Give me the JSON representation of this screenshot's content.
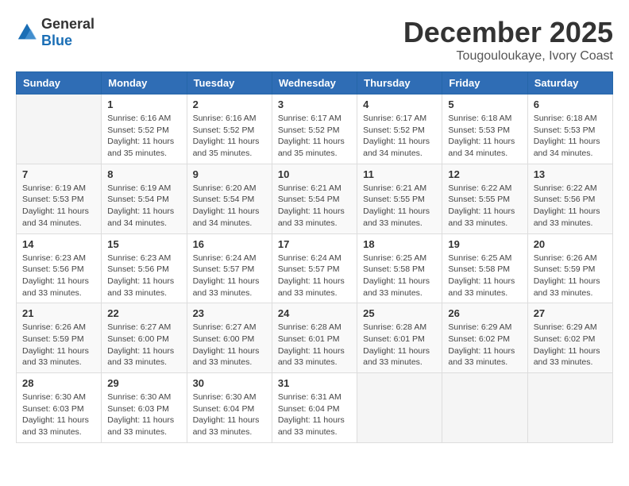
{
  "logo": {
    "text_general": "General",
    "text_blue": "Blue"
  },
  "title": {
    "month": "December 2025",
    "location": "Tougouloukaye, Ivory Coast"
  },
  "headers": [
    "Sunday",
    "Monday",
    "Tuesday",
    "Wednesday",
    "Thursday",
    "Friday",
    "Saturday"
  ],
  "weeks": [
    [
      {
        "day": "",
        "info": ""
      },
      {
        "day": "1",
        "info": "Sunrise: 6:16 AM\nSunset: 5:52 PM\nDaylight: 11 hours and 35 minutes."
      },
      {
        "day": "2",
        "info": "Sunrise: 6:16 AM\nSunset: 5:52 PM\nDaylight: 11 hours and 35 minutes."
      },
      {
        "day": "3",
        "info": "Sunrise: 6:17 AM\nSunset: 5:52 PM\nDaylight: 11 hours and 35 minutes."
      },
      {
        "day": "4",
        "info": "Sunrise: 6:17 AM\nSunset: 5:52 PM\nDaylight: 11 hours and 34 minutes."
      },
      {
        "day": "5",
        "info": "Sunrise: 6:18 AM\nSunset: 5:53 PM\nDaylight: 11 hours and 34 minutes."
      },
      {
        "day": "6",
        "info": "Sunrise: 6:18 AM\nSunset: 5:53 PM\nDaylight: 11 hours and 34 minutes."
      }
    ],
    [
      {
        "day": "7",
        "info": "Sunrise: 6:19 AM\nSunset: 5:53 PM\nDaylight: 11 hours and 34 minutes."
      },
      {
        "day": "8",
        "info": "Sunrise: 6:19 AM\nSunset: 5:54 PM\nDaylight: 11 hours and 34 minutes."
      },
      {
        "day": "9",
        "info": "Sunrise: 6:20 AM\nSunset: 5:54 PM\nDaylight: 11 hours and 34 minutes."
      },
      {
        "day": "10",
        "info": "Sunrise: 6:21 AM\nSunset: 5:54 PM\nDaylight: 11 hours and 33 minutes."
      },
      {
        "day": "11",
        "info": "Sunrise: 6:21 AM\nSunset: 5:55 PM\nDaylight: 11 hours and 33 minutes."
      },
      {
        "day": "12",
        "info": "Sunrise: 6:22 AM\nSunset: 5:55 PM\nDaylight: 11 hours and 33 minutes."
      },
      {
        "day": "13",
        "info": "Sunrise: 6:22 AM\nSunset: 5:56 PM\nDaylight: 11 hours and 33 minutes."
      }
    ],
    [
      {
        "day": "14",
        "info": "Sunrise: 6:23 AM\nSunset: 5:56 PM\nDaylight: 11 hours and 33 minutes."
      },
      {
        "day": "15",
        "info": "Sunrise: 6:23 AM\nSunset: 5:56 PM\nDaylight: 11 hours and 33 minutes."
      },
      {
        "day": "16",
        "info": "Sunrise: 6:24 AM\nSunset: 5:57 PM\nDaylight: 11 hours and 33 minutes."
      },
      {
        "day": "17",
        "info": "Sunrise: 6:24 AM\nSunset: 5:57 PM\nDaylight: 11 hours and 33 minutes."
      },
      {
        "day": "18",
        "info": "Sunrise: 6:25 AM\nSunset: 5:58 PM\nDaylight: 11 hours and 33 minutes."
      },
      {
        "day": "19",
        "info": "Sunrise: 6:25 AM\nSunset: 5:58 PM\nDaylight: 11 hours and 33 minutes."
      },
      {
        "day": "20",
        "info": "Sunrise: 6:26 AM\nSunset: 5:59 PM\nDaylight: 11 hours and 33 minutes."
      }
    ],
    [
      {
        "day": "21",
        "info": "Sunrise: 6:26 AM\nSunset: 5:59 PM\nDaylight: 11 hours and 33 minutes."
      },
      {
        "day": "22",
        "info": "Sunrise: 6:27 AM\nSunset: 6:00 PM\nDaylight: 11 hours and 33 minutes."
      },
      {
        "day": "23",
        "info": "Sunrise: 6:27 AM\nSunset: 6:00 PM\nDaylight: 11 hours and 33 minutes."
      },
      {
        "day": "24",
        "info": "Sunrise: 6:28 AM\nSunset: 6:01 PM\nDaylight: 11 hours and 33 minutes."
      },
      {
        "day": "25",
        "info": "Sunrise: 6:28 AM\nSunset: 6:01 PM\nDaylight: 11 hours and 33 minutes."
      },
      {
        "day": "26",
        "info": "Sunrise: 6:29 AM\nSunset: 6:02 PM\nDaylight: 11 hours and 33 minutes."
      },
      {
        "day": "27",
        "info": "Sunrise: 6:29 AM\nSunset: 6:02 PM\nDaylight: 11 hours and 33 minutes."
      }
    ],
    [
      {
        "day": "28",
        "info": "Sunrise: 6:30 AM\nSunset: 6:03 PM\nDaylight: 11 hours and 33 minutes."
      },
      {
        "day": "29",
        "info": "Sunrise: 6:30 AM\nSunset: 6:03 PM\nDaylight: 11 hours and 33 minutes."
      },
      {
        "day": "30",
        "info": "Sunrise: 6:30 AM\nSunset: 6:04 PM\nDaylight: 11 hours and 33 minutes."
      },
      {
        "day": "31",
        "info": "Sunrise: 6:31 AM\nSunset: 6:04 PM\nDaylight: 11 hours and 33 minutes."
      },
      {
        "day": "",
        "info": ""
      },
      {
        "day": "",
        "info": ""
      },
      {
        "day": "",
        "info": ""
      }
    ]
  ]
}
